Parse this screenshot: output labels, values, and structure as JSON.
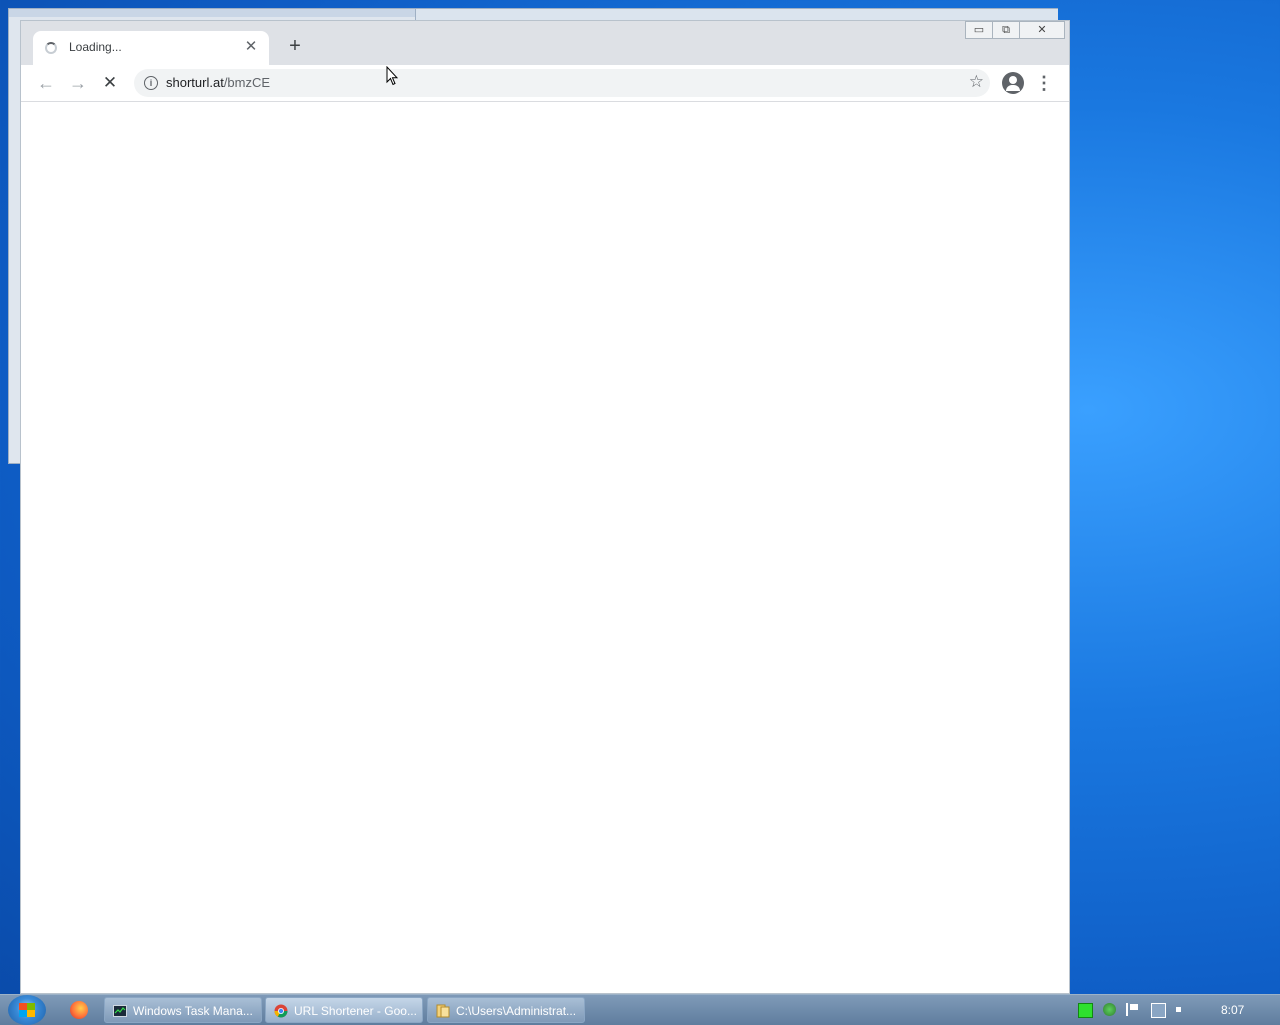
{
  "browser": {
    "tab": {
      "title": "Loading...",
      "close_glyph": "✕"
    },
    "new_tab_glyph": "+",
    "window_controls": {
      "minimize": "▭",
      "maximize": "⧉",
      "close": "✕"
    },
    "toolbar": {
      "back_glyph": "←",
      "forward_glyph": "→",
      "stop_glyph": "✕",
      "url_host": "shorturl.at",
      "url_path": "/bmzCE",
      "info_glyph": "i",
      "star_glyph": "☆",
      "menu_glyph": "⋮"
    }
  },
  "taskbar": {
    "items": [
      {
        "label": "Windows Task Mana...",
        "icon": "task-manager-icon"
      },
      {
        "label": "URL Shortener - Goo...",
        "icon": "chrome-icon"
      },
      {
        "label": "C:\\Users\\Administrat...",
        "icon": "folder-icon"
      }
    ],
    "clock": "8:07"
  },
  "colors": {
    "desktop": "#1a78e0",
    "tabstrip": "#dee1e6",
    "omnibox": "#f1f3f4"
  }
}
